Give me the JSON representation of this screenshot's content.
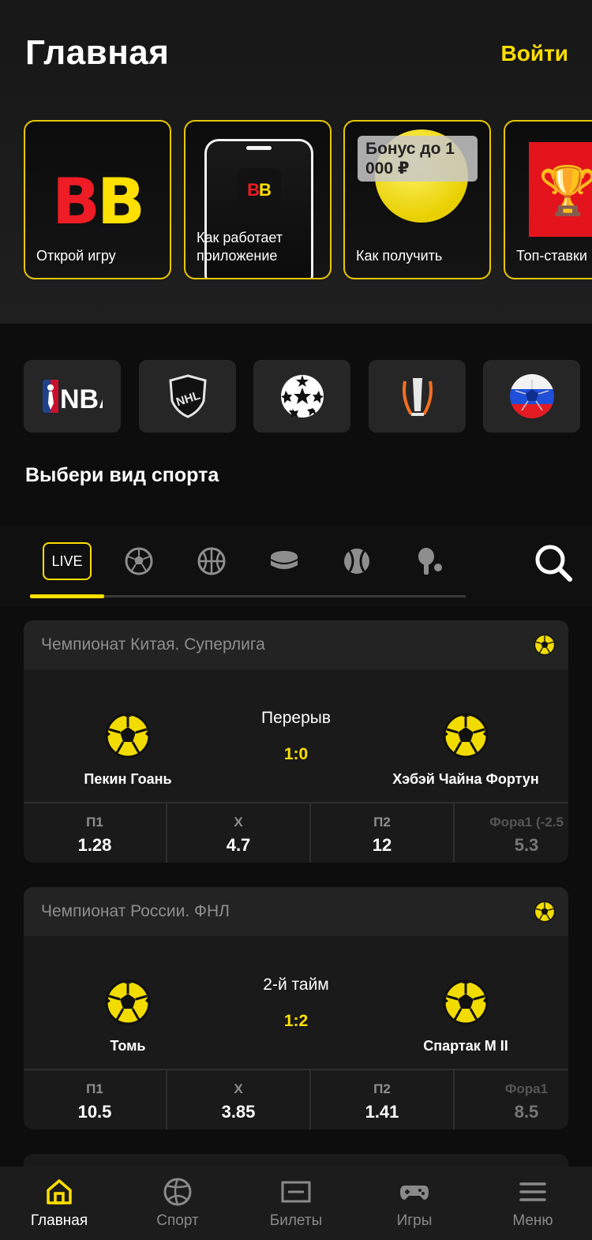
{
  "header": {
    "title": "Главная",
    "login_label": "Войти"
  },
  "stories": [
    {
      "label": "Открой игру",
      "logo_text": "BB"
    },
    {
      "label": "Как работает приложение",
      "logo_text": "BB"
    },
    {
      "label": "Как получить",
      "tag": "Бонус до 1 000 ₽"
    },
    {
      "label": "Топ-ставки"
    }
  ],
  "leagues": [
    {
      "name": "nba-logo",
      "text": "NBA"
    },
    {
      "name": "nhl-logo",
      "text": "NHL"
    },
    {
      "name": "champions-league-logo"
    },
    {
      "name": "europa-league-logo"
    },
    {
      "name": "russia-ball-logo"
    }
  ],
  "section": {
    "title": "Выбери вид спорта"
  },
  "sport_tabs": {
    "live_label": "LIVE",
    "icons": [
      "football-icon",
      "basketball-icon",
      "hockey-puck-icon",
      "tennis-icon",
      "table-tennis-icon"
    ]
  },
  "matches": [
    {
      "league": "Чемпионат Китая. Суперлига",
      "status": "Перерыв",
      "score": "1:0",
      "home": "Пекин Гоань",
      "away": "Хэбэй Чайна Фортун",
      "odds": [
        {
          "label": "П1",
          "value": "1.28"
        },
        {
          "label": "Х",
          "value": "4.7"
        },
        {
          "label": "П2",
          "value": "12"
        },
        {
          "label": "Фора1 (-2.5",
          "value": "5.3"
        }
      ]
    },
    {
      "league": "Чемпионат России. ФНЛ",
      "status": "2-й тайм",
      "score": "1:2",
      "home": "Томь",
      "away": "Спартак М II",
      "odds": [
        {
          "label": "П1",
          "value": "10.5"
        },
        {
          "label": "Х",
          "value": "3.85"
        },
        {
          "label": "П2",
          "value": "1.41"
        },
        {
          "label": "Фора1",
          "value": "8.5"
        }
      ]
    }
  ],
  "nav": [
    {
      "label": "Главная",
      "icon": "home-icon"
    },
    {
      "label": "Спорт",
      "icon": "volleyball-icon"
    },
    {
      "label": "Билеты",
      "icon": "ticket-icon"
    },
    {
      "label": "Игры",
      "icon": "gamepad-icon"
    },
    {
      "label": "Меню",
      "icon": "menu-icon"
    }
  ],
  "colors": {
    "accent": "#ffe000",
    "brand_red": "#ee1c25",
    "background": "#0d0d0d"
  }
}
